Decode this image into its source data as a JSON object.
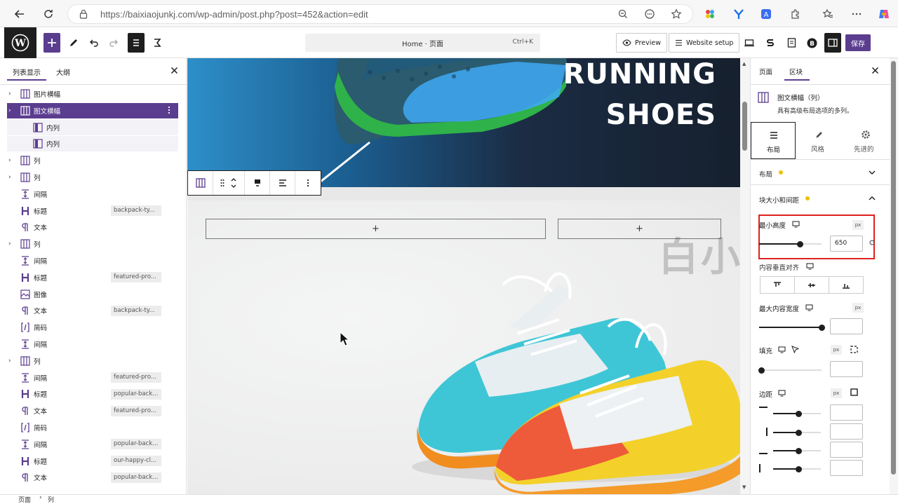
{
  "browser": {
    "url": "https://baixiaojunkj.com/wp-admin/post.php?post=452&action=edit",
    "icons": [
      "back-icon",
      "reload-icon",
      "lock-icon",
      "zoom-icon",
      "tracking-icon",
      "star-icon",
      "extensions-icon",
      "favorites-icon",
      "more-icon",
      "copilot-icon"
    ]
  },
  "toolbar": {
    "command_text": "Home · 页面",
    "command_shortcut": "Ctrl+K",
    "preview_label": "Preview",
    "website_setup_label": "Website setup",
    "save_label": "保存",
    "accent_color": "#5b3d8f"
  },
  "left_panel": {
    "tab_list": "列表显示",
    "tab_outline": "大纲",
    "rows": [
      {
        "label": "图片横幅",
        "icon": "columns-icon",
        "caret": "›",
        "indent": 0,
        "anchor": ""
      },
      {
        "label": "图文横幅",
        "icon": "columns-icon",
        "caret": "›",
        "indent": 0,
        "anchor": "",
        "selected": true
      },
      {
        "label": "内列",
        "icon": "column-icon",
        "caret": "",
        "indent": 1,
        "anchor": ""
      },
      {
        "label": "内列",
        "icon": "column-icon",
        "caret": "",
        "indent": 1,
        "anchor": ""
      },
      {
        "label": "列",
        "icon": "columns-icon",
        "caret": "›",
        "indent": 0,
        "anchor": ""
      },
      {
        "label": "列",
        "icon": "columns-icon",
        "caret": "›",
        "indent": 0,
        "anchor": ""
      },
      {
        "label": "间隔",
        "icon": "spacer-icon",
        "caret": "",
        "indent": 0,
        "anchor": ""
      },
      {
        "label": "标题",
        "icon": "heading-icon",
        "caret": "",
        "indent": 0,
        "anchor": "backpack-ty..."
      },
      {
        "label": "文本",
        "icon": "paragraph-icon",
        "caret": "",
        "indent": 0,
        "anchor": ""
      },
      {
        "label": "列",
        "icon": "columns-icon",
        "caret": "›",
        "indent": 0,
        "anchor": ""
      },
      {
        "label": "间隔",
        "icon": "spacer-icon",
        "caret": "",
        "indent": 0,
        "anchor": ""
      },
      {
        "label": "标题",
        "icon": "heading-icon",
        "caret": "",
        "indent": 0,
        "anchor": "featured-pro..."
      },
      {
        "label": "图像",
        "icon": "image-icon",
        "caret": "",
        "indent": 0,
        "anchor": ""
      },
      {
        "label": "文本",
        "icon": "paragraph-icon",
        "caret": "",
        "indent": 0,
        "anchor": "backpack-ty..."
      },
      {
        "label": "简码",
        "icon": "shortcode-icon",
        "caret": "",
        "indent": 0,
        "anchor": ""
      },
      {
        "label": "间隔",
        "icon": "spacer-icon",
        "caret": "",
        "indent": 0,
        "anchor": ""
      },
      {
        "label": "列",
        "icon": "columns-icon",
        "caret": "›",
        "indent": 0,
        "anchor": ""
      },
      {
        "label": "间隔",
        "icon": "spacer-icon",
        "caret": "",
        "indent": 0,
        "anchor": "featured-pro..."
      },
      {
        "label": "标题",
        "icon": "heading-icon",
        "caret": "",
        "indent": 0,
        "anchor": "popular-back..."
      },
      {
        "label": "文本",
        "icon": "paragraph-icon",
        "caret": "",
        "indent": 0,
        "anchor": "featured-pro..."
      },
      {
        "label": "简码",
        "icon": "shortcode-icon",
        "caret": "",
        "indent": 0,
        "anchor": ""
      },
      {
        "label": "间隔",
        "icon": "spacer-icon",
        "caret": "",
        "indent": 0,
        "anchor": "popular-back..."
      },
      {
        "label": "标题",
        "icon": "heading-icon",
        "caret": "",
        "indent": 0,
        "anchor": "our-happy-cl..."
      },
      {
        "label": "文本",
        "icon": "paragraph-icon",
        "caret": "",
        "indent": 0,
        "anchor": "popular-back..."
      }
    ]
  },
  "canvas": {
    "hero_line1": "RUNNING",
    "hero_line2": "SHOES",
    "add_block_symbol": "+",
    "watermark": "白小菌"
  },
  "right_panel": {
    "tab_page": "页面",
    "tab_block": "区块",
    "block_name": "图文横幅（列）",
    "block_desc": "具有高级布局选项的多列。",
    "subtab_layout": "布局",
    "subtab_style": "风格",
    "subtab_advanced": "先进的",
    "section_layout": "布局",
    "section_size": "块大小和间距",
    "min_height_label": "最小高度",
    "min_height_value": "650",
    "unit_px": "px",
    "vertical_align_label": "内容垂直对齐",
    "max_width_label": "最大内容宽度",
    "padding_label": "填充",
    "margin_label": "边距",
    "highlight_color": "#e02020"
  },
  "breadcrumb": {
    "page": "页面",
    "sep": "›",
    "current": "列"
  }
}
